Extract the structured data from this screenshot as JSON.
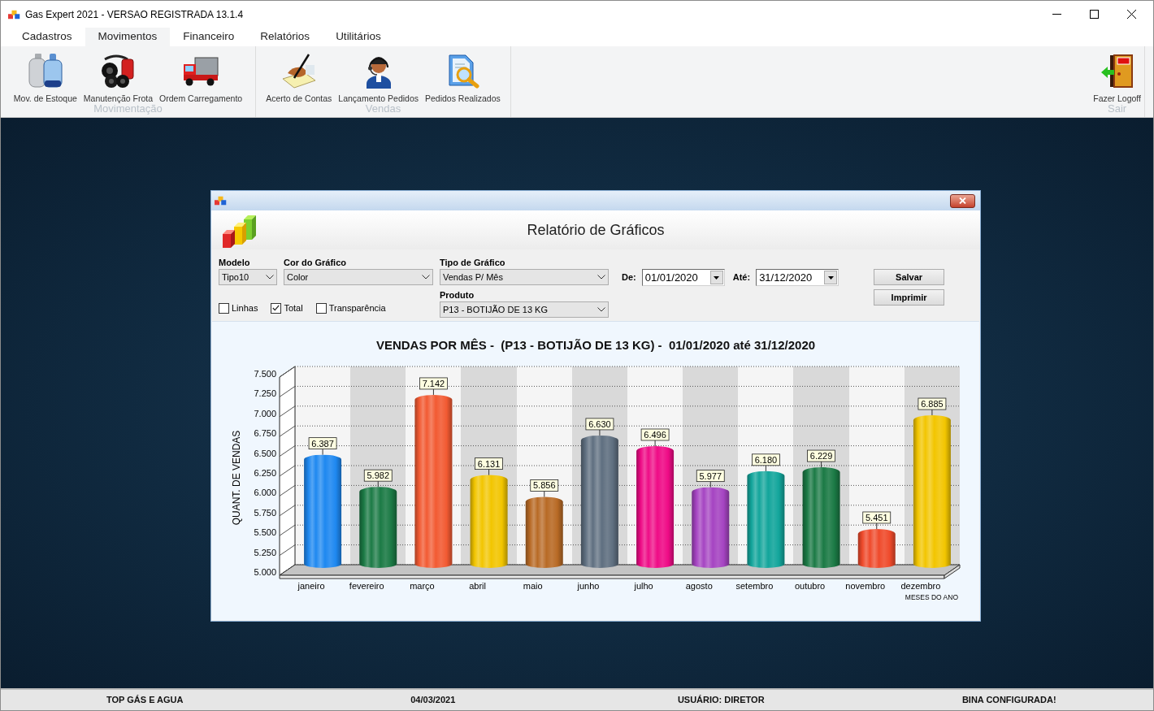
{
  "window": {
    "title": "Gas Expert 2021 - VERSAO REGISTRADA 13.1.4"
  },
  "menu": [
    {
      "label": "Cadastros",
      "selected": false
    },
    {
      "label": "Movimentos",
      "selected": true
    },
    {
      "label": "Financeiro",
      "selected": false
    },
    {
      "label": "Relatórios",
      "selected": false
    },
    {
      "label": "Utilitários",
      "selected": false
    }
  ],
  "ribbon": [
    {
      "label": "Movimentação",
      "items": [
        "Mov. de Estoque",
        "Manutenção Frota",
        "Ordem Carregamento"
      ]
    },
    {
      "label": "Vendas",
      "items": [
        "Acerto de Contas",
        "Lançamento Pedidos",
        "Pedidos Realizados"
      ]
    },
    {
      "label": "Sair",
      "items": [
        "Fazer Logoff"
      ]
    }
  ],
  "dialog": {
    "heading": "Relatório de Gráficos",
    "selects": [
      {
        "label": "Modelo",
        "value": "Tipo10"
      },
      {
        "label": "Cor do Gráfico",
        "value": "Color"
      },
      {
        "label": "Tipo de Gráfico",
        "value": "Vendas P/ Mês"
      },
      {
        "label": "Produto",
        "value": "P13 - BOTIJÃO DE 13 KG"
      }
    ],
    "checkboxes": [
      {
        "label": "Linhas",
        "checked": false
      },
      {
        "label": "Total",
        "checked": true
      },
      {
        "label": "Transparência",
        "checked": false
      }
    ],
    "dates": [
      {
        "label": "De:",
        "value": "01/01/2020"
      },
      {
        "label": "Até:",
        "value": "31/12/2020"
      }
    ],
    "buttons": [
      "Salvar",
      "Imprimir"
    ],
    "chart_data": {
      "type": "bar",
      "title": "VENDAS POR MÊS -  (P13 - BOTIJÃO DE 13 KG) -  01/01/2020 até 31/12/2020",
      "xlabel": "MESES DO ANO",
      "ylabel": "QUANT. DE VENDAS",
      "categories": [
        "janeiro",
        "fevereiro",
        "março",
        "abril",
        "maio",
        "junho",
        "julho",
        "agosto",
        "setembro",
        "outubro",
        "novembro",
        "dezembro"
      ],
      "series": [
        {
          "values": [
            6387,
            5982,
            7142,
            6131,
            5856,
            6630,
            6496,
            5977,
            6180,
            6229,
            5451,
            6885
          ],
          "colors": [
            "#1e88f0",
            "#1b7a45",
            "#f25a32",
            "#f2c500",
            "#b86a25",
            "#5f6f80",
            "#ef0b86",
            "#a544c2",
            "#12a59b",
            "#1b7a45",
            "#ef4a2b",
            "#f2c500"
          ]
        }
      ],
      "ylim": [
        5000,
        7500
      ],
      "yticks": [
        {
          "value": 5000,
          "label": "5.000"
        },
        {
          "value": 5250,
          "label": "5.250"
        },
        {
          "value": 5500,
          "label": "5.500"
        },
        {
          "value": 5750,
          "label": "5.750"
        },
        {
          "value": 6000,
          "label": "6.000"
        },
        {
          "value": 6250,
          "label": "6.250"
        },
        {
          "value": 6500,
          "label": "6.500"
        },
        {
          "value": 6750,
          "label": "6.750"
        },
        {
          "value": 7000,
          "label": "7.000"
        },
        {
          "value": 7250,
          "label": "7.250"
        },
        {
          "value": 7500,
          "label": "7.500"
        }
      ],
      "grid": true,
      "value_labels": [
        "6.387",
        "5.982",
        "7.142",
        "6.131",
        "5.856",
        "6.630",
        "6.496",
        "5.977",
        "6.180",
        "6.229",
        "5.451",
        "6.885"
      ]
    }
  },
  "status_bar": [
    "TOP GÁS E AGUA",
    "04/03/2021",
    "USUÁRIO: DIRETOR",
    "BINA CONFIGURADA!"
  ]
}
